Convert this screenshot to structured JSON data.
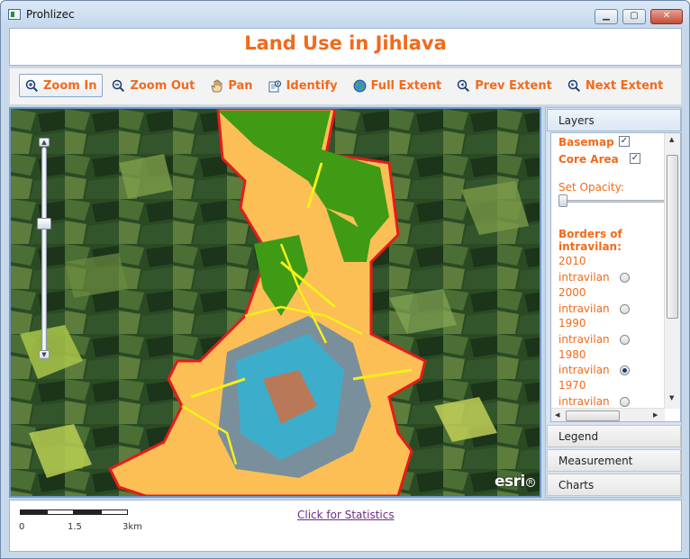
{
  "window": {
    "title": "Prohlizec"
  },
  "app": {
    "title": "Land Use in Jihlava"
  },
  "toolbar": {
    "tools": [
      {
        "label": "Zoom In",
        "icon": "zoom-in-icon"
      },
      {
        "label": "Zoom Out",
        "icon": "zoom-out-icon"
      },
      {
        "label": "Pan",
        "icon": "hand-icon"
      },
      {
        "label": "Identify",
        "icon": "identify-icon"
      },
      {
        "label": "Full Extent",
        "icon": "globe-icon"
      },
      {
        "label": "Prev Extent",
        "icon": "prev-extent-icon"
      },
      {
        "label": "Next Extent",
        "icon": "next-extent-icon"
      }
    ]
  },
  "map": {
    "logo_text": "esri",
    "zoom_level_fraction": 0.4
  },
  "panel": {
    "headers": {
      "layers": "Layers",
      "legend": "Legend",
      "measurement": "Measurement",
      "charts": "Charts"
    },
    "layers": {
      "basemap_label": "Basemap",
      "basemap_checked": true,
      "core_area_label": "Core Area",
      "core_area_checked": true,
      "opacity_label": "Set Opacity:",
      "opacity_value": 0.0,
      "borders_label_1": "Borders of",
      "borders_label_2": "intravilan:",
      "years": [
        {
          "year": "2010",
          "label": "intravilan",
          "selected": false
        },
        {
          "year": "2000",
          "label": "intravilan",
          "selected": false
        },
        {
          "year": "1990",
          "label": "intravilan",
          "selected": false
        },
        {
          "year": "1980",
          "label": "intravilan",
          "selected": true
        },
        {
          "year": "1970",
          "label": "intravilan",
          "selected": false
        }
      ]
    }
  },
  "status": {
    "scale_labels": [
      "0",
      "1.5",
      "3km"
    ],
    "stats_link": "Click for Statistics"
  },
  "colors": {
    "accent": "#f26a1b",
    "boundary": "#e51b1b",
    "urban": "#fbbf55",
    "green": "#3f9a14",
    "water": "#2db5d8",
    "yellow": "#f5f019"
  }
}
